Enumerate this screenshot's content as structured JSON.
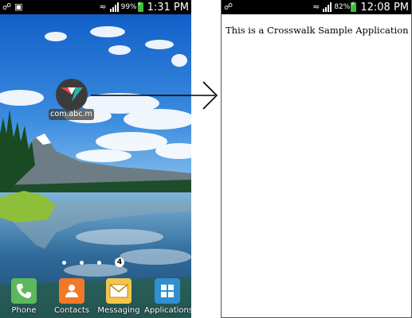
{
  "left_screen": {
    "status": {
      "battery_pct": "99%",
      "time": "1:31 PM"
    },
    "app_shortcut": {
      "label": "com.abc.m"
    },
    "page_indicator": {
      "current": "4"
    },
    "dock": [
      {
        "label": "Phone",
        "icon": "phone-icon",
        "color": "#5cb85c"
      },
      {
        "label": "Contacts",
        "icon": "contacts-icon",
        "color": "#f0792a"
      },
      {
        "label": "Messaging",
        "icon": "messaging-icon",
        "color": "#f3c64a"
      },
      {
        "label": "Applications",
        "icon": "applications-icon",
        "color": "#2f8fd0"
      }
    ]
  },
  "right_screen": {
    "status": {
      "battery_pct": "82%",
      "time": "12:08 PM"
    },
    "content_text": "This is a Crosswalk Sample Application"
  }
}
